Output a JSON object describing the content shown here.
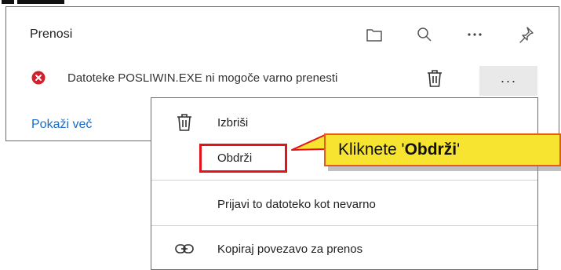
{
  "panel": {
    "title": "Prenosi",
    "header_icons": [
      "folder-icon",
      "search-icon",
      "more-horizontal-icon",
      "pin-icon"
    ],
    "download_item": {
      "status_icon": "error-icon",
      "text": "Datoteke POSLIWIN.EXE ni mogoče varno prenesti",
      "more_label": "···"
    },
    "show_more_label": "Pokaži več"
  },
  "context_menu": {
    "items": [
      {
        "label": "Izbriši",
        "icon": "trash-icon"
      },
      {
        "label": "Obdrži",
        "icon": ""
      },
      {
        "label": "Prijavi to datoteko kot nevarno",
        "icon": ""
      },
      {
        "label": "Kopiraj povezavo za prenos",
        "icon": "link-icon"
      }
    ]
  },
  "callout": {
    "prefix": "Kliknete '",
    "bold": "Obdrži",
    "suffix": "'"
  },
  "colors": {
    "link": "#1b6cc8",
    "callout_fill": "#f7e430",
    "callout_border": "#e85c10",
    "highlight": "#e0141a",
    "error": "#d4202a"
  }
}
